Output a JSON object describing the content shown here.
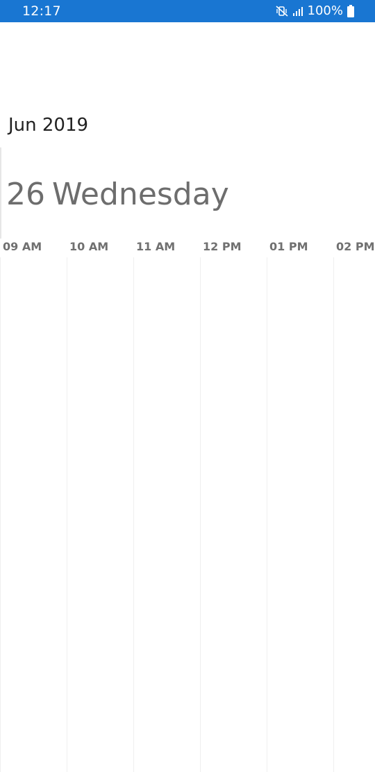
{
  "status_bar": {
    "time": "12:17",
    "battery_text": "100%",
    "icons": [
      "vibrate-mute-icon",
      "signal-icon",
      "battery-icon"
    ],
    "background": "#1976d2"
  },
  "calendar": {
    "month_year": "Jun 2019",
    "day_number": "26",
    "day_name": "Wednesday",
    "time_slots": [
      "09 AM",
      "10 AM",
      "11 AM",
      "12 PM",
      "01 PM",
      "02 PM"
    ]
  }
}
